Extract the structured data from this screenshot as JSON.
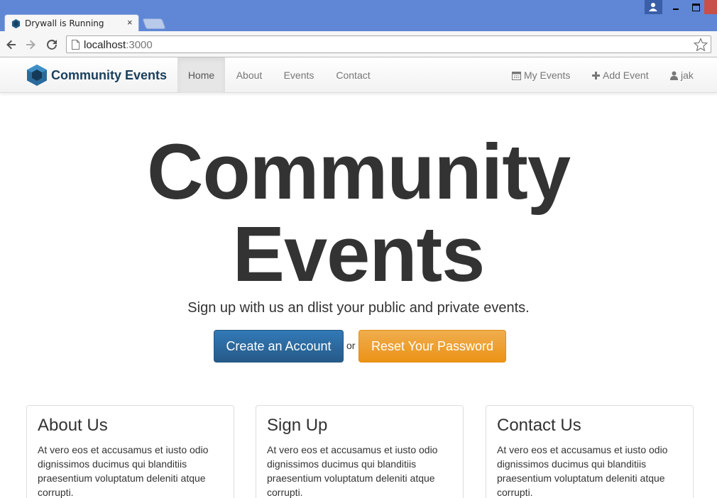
{
  "browser": {
    "tab_title": "Drywall is Running",
    "tab_close": "×",
    "url_host": "localhost",
    "url_port": ":3000"
  },
  "navbar": {
    "brand": "Community Events",
    "links": [
      "Home",
      "About",
      "Events",
      "Contact"
    ],
    "active": "Home",
    "right": {
      "my_events": "My Events",
      "add_event": "Add Event",
      "user": "jak"
    }
  },
  "hero": {
    "title_line1": "Community",
    "title_line2": "Events",
    "subtitle": "Sign up with us an dlist your public and private events.",
    "primary_button": "Create an Account",
    "or": "or",
    "secondary_button": "Reset Your Password"
  },
  "cards": [
    {
      "title": "About Us",
      "body": "At vero eos et accusamus et iusto odio dignissimos ducimus qui blanditiis praesentium voluptatum deleniti atque corrupti."
    },
    {
      "title": "Sign Up",
      "body": "At vero eos et accusamus et iusto odio dignissimos ducimus qui blanditiis praesentium voluptatum deleniti atque corrupti."
    },
    {
      "title": "Contact Us",
      "body": "At vero eos et accusamus et iusto odio dignissimos ducimus qui blanditiis praesentium voluptatum deleniti atque corrupti."
    }
  ],
  "colors": {
    "titlebar": "#5f87d6",
    "brand": "#1a3f5c",
    "primary": "#286090",
    "warning": "#f0ad4e"
  },
  "icons": [
    "user-icon",
    "back-arrow-icon",
    "forward-arrow-icon",
    "reload-icon",
    "page-icon",
    "star-icon",
    "logo-icon",
    "calendar-icon",
    "plus-icon"
  ]
}
